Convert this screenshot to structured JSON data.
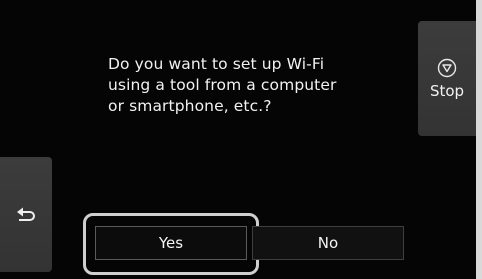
{
  "dialog": {
    "message": "Do you want to set up Wi-Fi\nusing a tool from a computer\nor smartphone, etc.?"
  },
  "buttons": {
    "stop_label": "Stop",
    "yes_label": "Yes",
    "no_label": "No"
  },
  "icons": {
    "stop": "stop-icon",
    "back": "back-arrow-icon"
  },
  "colors": {
    "background": "#050505",
    "panel_button": "#363636",
    "text": "#f2f2f2",
    "highlight": "#cfcfcf"
  }
}
